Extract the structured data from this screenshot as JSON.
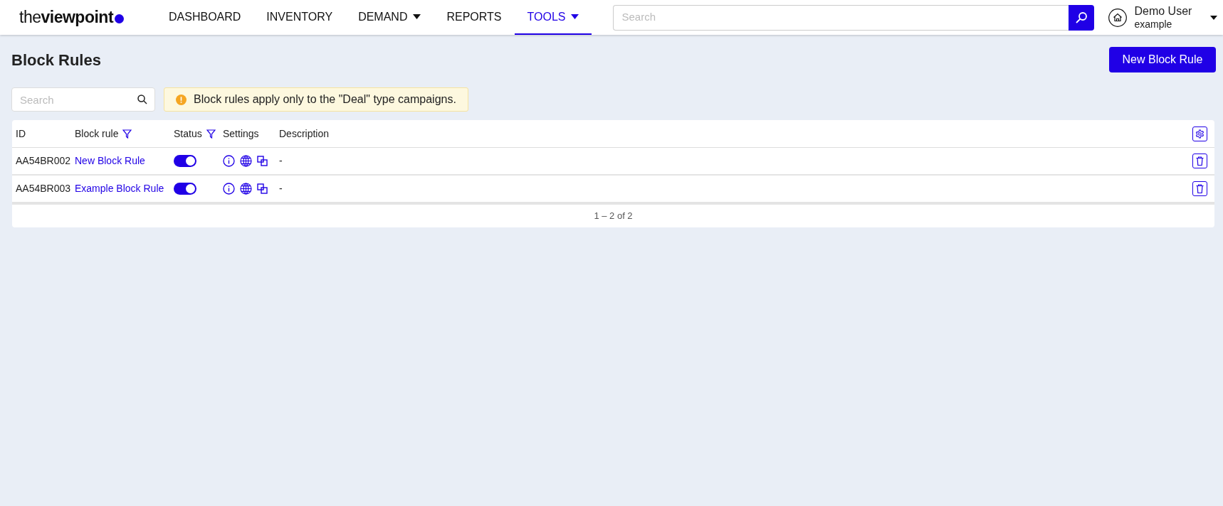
{
  "logo": {
    "text": "the**viewpoint**"
  },
  "nav": [
    {
      "label": "DASHBOARD",
      "selected": false,
      "dropdown": false
    },
    {
      "label": "INVENTORY",
      "selected": false,
      "dropdown": false
    },
    {
      "label": "DEMAND",
      "selected": false,
      "dropdown": true
    },
    {
      "label": "REPORTS",
      "selected": false,
      "dropdown": false
    },
    {
      "label": "TOOLS",
      "selected": true,
      "dropdown": true
    }
  ],
  "header_search": {
    "placeholder": "Search"
  },
  "user": {
    "name": "Demo User",
    "account": "example"
  },
  "page": {
    "title": "Block Rules",
    "new_button": "New Block Rule"
  },
  "search": {
    "placeholder": "Search"
  },
  "notice": {
    "text": "Block rules apply only to the \"Deal\" type campaigns."
  },
  "table": {
    "columns": [
      {
        "label": "ID",
        "filter": false
      },
      {
        "label": "Block rule",
        "filter": true
      },
      {
        "label": "Status",
        "filter": true
      },
      {
        "label": "Settings",
        "filter": false
      },
      {
        "label": "Description",
        "filter": false
      }
    ],
    "rows": [
      {
        "id": "AA54BR002",
        "name": "New Block Rule",
        "on": true,
        "description": "-"
      },
      {
        "id": "AA54BR003",
        "name": "Example Block Rule",
        "on": true,
        "description": "-"
      }
    ],
    "footer": "1 – 2 of 2"
  }
}
